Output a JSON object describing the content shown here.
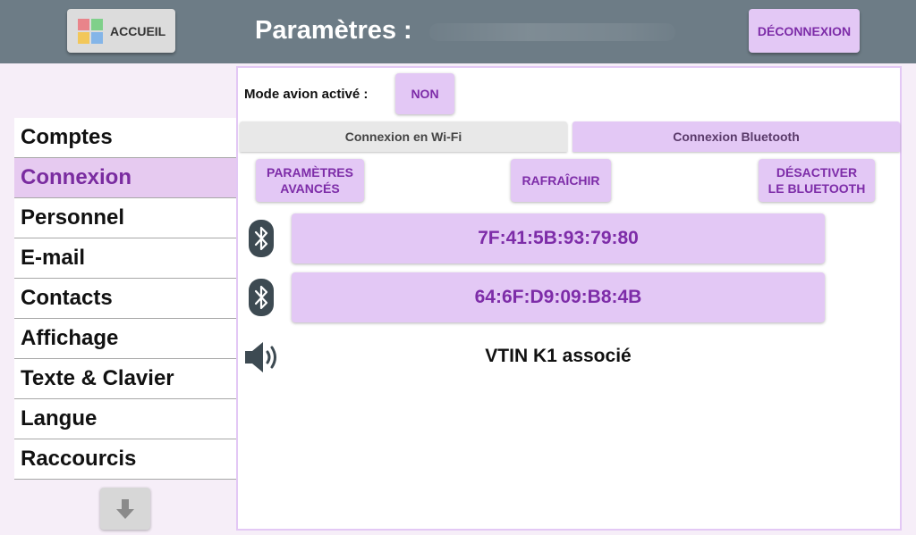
{
  "header": {
    "home_label": "ACCUEIL",
    "title": "Paramètres :",
    "logout_label": "DÉCONNEXION",
    "logo_colors": [
      "#e9848a",
      "#7fd08a",
      "#f2c75a",
      "#84b5e8"
    ]
  },
  "sidebar": {
    "items": [
      {
        "label": "Comptes"
      },
      {
        "label": "Connexion"
      },
      {
        "label": "Personnel"
      },
      {
        "label": "E-mail"
      },
      {
        "label": "Contacts"
      },
      {
        "label": "Affichage"
      },
      {
        "label": "Texte & Clavier"
      },
      {
        "label": "Langue"
      },
      {
        "label": "Raccourcis"
      }
    ],
    "active_index": 1
  },
  "connection": {
    "airplane_label": "Mode avion activé :",
    "airplane_value": "NON",
    "tabs": [
      {
        "label": "Connexion en Wi-Fi"
      },
      {
        "label": "Connexion Bluetooth"
      }
    ],
    "actions": {
      "advanced_line1": "PARAMÈTRES",
      "advanced_line2": "AVANCÉS",
      "refresh": "RAFRAÎCHIR",
      "disable_line1": "DÉSACTIVER",
      "disable_line2": "LE BLUETOOTH"
    },
    "devices": [
      {
        "address": "7F:41:5B:93:79:80"
      },
      {
        "address": "64:6F:D9:09:B8:4B"
      }
    ],
    "paired_text": "VTIN K1 associé"
  },
  "colors": {
    "topbar": "#6d7c86",
    "accent": "#e3c8f5",
    "accent_text": "#7d2ca8",
    "icon_dark": "#3d4a52"
  }
}
